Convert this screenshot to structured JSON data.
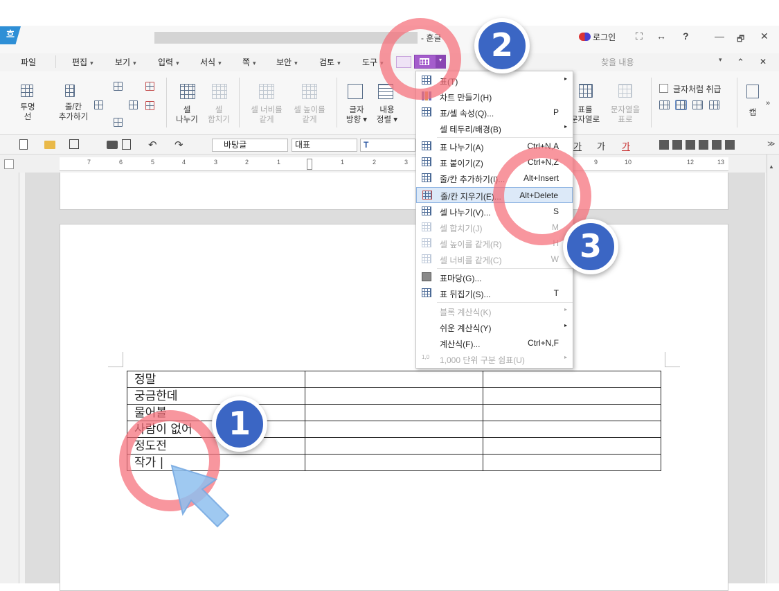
{
  "window": {
    "app_icon": "흐",
    "doc_title": "- 훈글",
    "login_label": "로그인",
    "controls": [
      "⛶",
      "↔",
      "?",
      "—",
      "🗗",
      "✕"
    ]
  },
  "menubar": {
    "items": [
      "파일",
      "편집",
      "보기",
      "입력",
      "서식",
      "쪽",
      "보안",
      "검토",
      "도구"
    ],
    "search_placeholder": "찾을 내용",
    "dropdown_arrow": "▾",
    "expand_icon": "⌃",
    "close_icon": "✕"
  },
  "ribbon": {
    "left": [
      {
        "label": "투명\n선"
      },
      {
        "label": "줄/칸\n추가하기"
      },
      {
        "label": "셀\n나누기"
      },
      {
        "label": "셀\n합치기",
        "disabled": true
      },
      {
        "label": "셀 너비를\n같게",
        "disabled": true
      },
      {
        "label": "셀 높이를\n같게",
        "disabled": true
      },
      {
        "label": "글자\n방향 ▾"
      },
      {
        "label": "내용\n정렬 ▾"
      }
    ],
    "right": [
      {
        "label": "표를\n문자열로"
      },
      {
        "label": "문자열을\n표로",
        "disabled": true
      }
    ],
    "checkbox_label": "글자처럼 취급",
    "caption_label": "캡",
    "more_icon": "»"
  },
  "toolbar2": {
    "style_value": "바탕글",
    "font_value": "대표",
    "right_glyphs": [
      "가",
      "가",
      "가"
    ]
  },
  "ruler": {
    "labels": [
      "7",
      "6",
      "5",
      "4",
      "3",
      "2",
      "1",
      "1",
      "2",
      "3",
      "9",
      "10",
      "12",
      "13"
    ]
  },
  "document": {
    "table_col1": [
      "정말",
      "궁금한데",
      "물어볼",
      "사람이 없어",
      "정도전",
      "작가 |"
    ]
  },
  "context_menu": {
    "items": [
      {
        "label": "표(T)",
        "shortcut": "",
        "sub": true,
        "disabled": false
      },
      {
        "label": "차트 만들기(H)",
        "shortcut": "",
        "sub": false,
        "disabled": false
      },
      {
        "label": "표/셀 속성(Q)...",
        "shortcut": "P",
        "sub": false,
        "disabled": false
      },
      {
        "label": "셀 테두리/배경(B)",
        "shortcut": "",
        "sub": true,
        "disabled": false
      },
      {
        "label": "표 나누기(A)",
        "shortcut": "Ctrl+N,A",
        "sub": false,
        "disabled": false
      },
      {
        "label": "표 붙이기(Z)",
        "shortcut": "Ctrl+N,Z",
        "sub": false,
        "disabled": false
      },
      {
        "label": "줄/칸 추가하기(I)...",
        "shortcut": "Alt+Insert",
        "sub": false,
        "disabled": false
      },
      {
        "label": "줄/칸 지우기(E)...",
        "shortcut": "Alt+Delete",
        "sub": false,
        "disabled": false,
        "highlight": true
      },
      {
        "label": "셀 나누기(V)...",
        "shortcut": "S",
        "sub": false,
        "disabled": false
      },
      {
        "label": "셀 합치기(J)",
        "shortcut": "M",
        "sub": false,
        "disabled": true
      },
      {
        "label": "셀 높이를 같게(R)",
        "shortcut": "H",
        "sub": false,
        "disabled": true
      },
      {
        "label": "셀 너비를 같게(C)",
        "shortcut": "W",
        "sub": false,
        "disabled": true
      },
      {
        "label": "표마당(G)...",
        "shortcut": "",
        "sub": false,
        "disabled": false
      },
      {
        "label": "표 뒤집기(S)...",
        "shortcut": "T",
        "sub": false,
        "disabled": false
      },
      {
        "label": "블록 계산식(K)",
        "shortcut": "",
        "sub": true,
        "disabled": true
      },
      {
        "label": "쉬운 계산식(Y)",
        "shortcut": "",
        "sub": true,
        "disabled": false
      },
      {
        "label": "계산식(F)...",
        "shortcut": "Ctrl+N,F",
        "sub": false,
        "disabled": false
      },
      {
        "label": "1,000 단위 구분 쉼표(U)",
        "shortcut": "",
        "sub": true,
        "disabled": true
      }
    ]
  },
  "annotations": {
    "badges": [
      "1",
      "2",
      "3"
    ]
  },
  "colors": {
    "accent": "#a45dcc",
    "badge": "#3b66c4",
    "ring": "#f56e78",
    "arrow": "#8ec0ee"
  }
}
